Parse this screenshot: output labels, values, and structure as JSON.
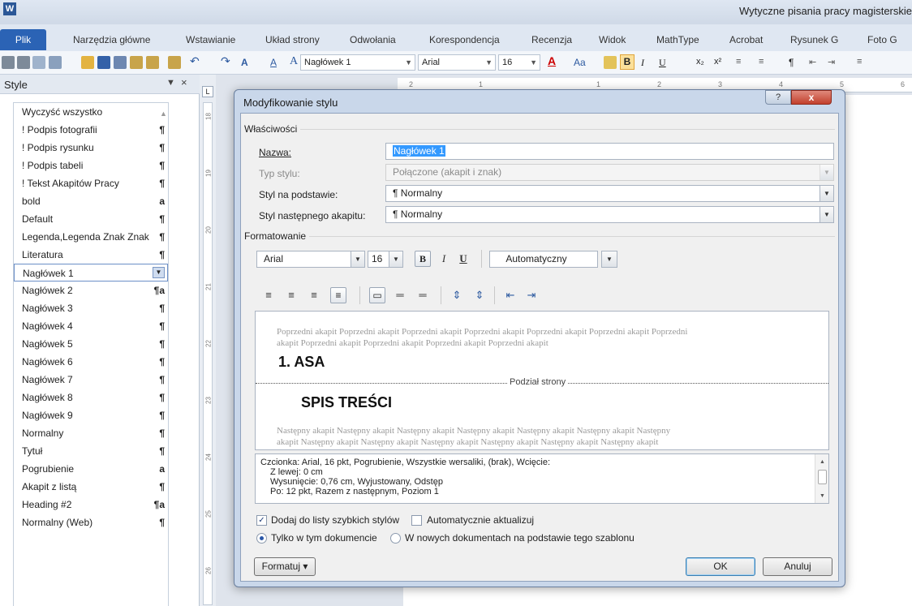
{
  "window": {
    "title": "Wytyczne pisania pracy magisterskie",
    "app_icon": "W"
  },
  "ribbon_tabs": [
    "Plik",
    "Narzędzia główne",
    "Wstawianie",
    "Układ strony",
    "Odwołania",
    "Korespondencja",
    "Recenzja",
    "Widok",
    "MathType",
    "Acrobat",
    "Rysunek G",
    "Foto G"
  ],
  "toolbar": {
    "style_combo": "Nagłówek 1",
    "font_combo": "Arial",
    "size_combo": "16",
    "bold": "B",
    "italic": "I",
    "underline": "U"
  },
  "styles_pane": {
    "title": "Style",
    "items": [
      {
        "label": "Wyczyść wszystko",
        "mark": ""
      },
      {
        "label": "! Podpis fotografii",
        "mark": "¶"
      },
      {
        "label": "! Podpis rysunku",
        "mark": "¶"
      },
      {
        "label": "! Podpis tabeli",
        "mark": "¶"
      },
      {
        "label": "! Tekst Akapitów Pracy",
        "mark": "¶"
      },
      {
        "label": "bold",
        "mark": "a"
      },
      {
        "label": "Default",
        "mark": "¶"
      },
      {
        "label": "Legenda,Legenda Znak Znak",
        "mark": "¶"
      },
      {
        "label": "Literatura",
        "mark": "¶"
      },
      {
        "label": "Nagłówek 1",
        "mark": ""
      },
      {
        "label": "Nagłówek 2",
        "mark": "¶a"
      },
      {
        "label": "Nagłówek 3",
        "mark": "¶"
      },
      {
        "label": "Nagłówek 4",
        "mark": "¶"
      },
      {
        "label": "Nagłówek 5",
        "mark": "¶"
      },
      {
        "label": "Nagłówek 6",
        "mark": "¶"
      },
      {
        "label": "Nagłówek 7",
        "mark": "¶"
      },
      {
        "label": "Nagłówek 8",
        "mark": "¶"
      },
      {
        "label": "Nagłówek 9",
        "mark": "¶"
      },
      {
        "label": "Normalny",
        "mark": "¶"
      },
      {
        "label": "Tytuł",
        "mark": "¶"
      },
      {
        "label": "Pogrubienie",
        "mark": "a"
      },
      {
        "label": "Akapit z listą",
        "mark": "¶"
      },
      {
        "label": "Heading #2",
        "mark": "¶a"
      },
      {
        "label": "Normalny (Web)",
        "mark": "¶"
      }
    ],
    "selected": "Nagłówek 1"
  },
  "vertical_ruler": [
    "18",
    "19",
    "20",
    "21",
    "22",
    "23",
    "24",
    "25",
    "26"
  ],
  "horizontal_ruler": [
    "2",
    "1",
    "1",
    "2",
    "3",
    "4",
    "5",
    "6"
  ],
  "dialog": {
    "title": "Modyfikowanie stylu",
    "help": "?",
    "close": "x",
    "properties_label": "Właściwości",
    "name_label": "Nazwa:",
    "name_value": "Nagłówek 1",
    "type_label": "Typ stylu:",
    "type_value": "Połączone (akapit i znak)",
    "based_label": "Styl na podstawie:",
    "based_value": "¶ Normalny",
    "next_label": "Styl następnego akapitu:",
    "next_value": "¶ Normalny",
    "formatting_label": "Formatowanie",
    "font": "Arial",
    "size": "16",
    "bold": "B",
    "italic": "I",
    "underline": "U",
    "color": "Automatyczny",
    "preview": {
      "prev_line1": "Poprzedni akapit Poprzedni akapit Poprzedni akapit Poprzedni akapit Poprzedni akapit Poprzedni akapit Poprzedni",
      "prev_line2": "akapit Poprzedni akapit Poprzedni akapit Poprzedni akapit Poprzedni akapit",
      "heading": "1. ASA",
      "page_break": "Podział strony",
      "heading2": "SPIS TREŚCI",
      "next_line1": "Następny akapit Następny akapit Następny akapit Następny akapit Następny akapit Następny akapit Następny",
      "next_line2": "akapit Następny akapit Następny akapit Następny akapit Następny akapit Następny akapit Następny akapit"
    },
    "description": [
      "Czcionka: Arial, 16 pkt, Pogrubienie, Wszystkie wersaliki, (brak), Wcięcie:",
      "Z lewej:  0 cm",
      "Wysunięcie:  0,76 cm, Wyjustowany, Odstęp",
      "Po:  12 pkt, Razem z następnym, Poziom 1"
    ],
    "add_quick_label": "Dodaj do listy szybkich stylów",
    "add_quick_checked": true,
    "auto_update_label": "Automatycznie aktualizuj",
    "auto_update_checked": false,
    "only_doc_label": "Tylko w tym dokumencie",
    "new_docs_label": "W nowych dokumentach na podstawie tego szablonu",
    "format_button": "Formatuj ▾",
    "ok": "OK",
    "cancel": "Anuluj"
  }
}
